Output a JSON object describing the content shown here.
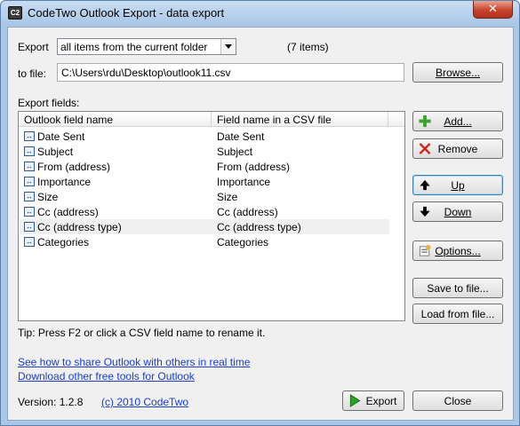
{
  "window": {
    "title": "CodeTwo Outlook Export - data export",
    "app_icon": "C2",
    "close_symbol": "✕"
  },
  "export": {
    "label": "Export",
    "selected_option": "all items from the current folder",
    "item_count": "(7 items)"
  },
  "to_file": {
    "label": "to file:",
    "value": "C:\\Users\\rdu\\Desktop\\outlook11.csv",
    "browse_label": "Browse..."
  },
  "fields": {
    "section_label": "Export fields:",
    "columns": [
      "Outlook field name",
      "Field name in a CSV file"
    ],
    "rows": [
      {
        "outlook": "Date Sent",
        "csv": "Date Sent"
      },
      {
        "outlook": "Subject",
        "csv": "Subject"
      },
      {
        "outlook": "From (address)",
        "csv": "From (address)"
      },
      {
        "outlook": "Importance",
        "csv": "Importance"
      },
      {
        "outlook": "Size",
        "csv": "Size"
      },
      {
        "outlook": "Cc (address)",
        "csv": "Cc (address)"
      },
      {
        "outlook": "Cc (address type)",
        "csv": "Cc (address type)"
      },
      {
        "outlook": "Categories",
        "csv": "Categories"
      }
    ],
    "selected_row": 6,
    "row_icon": "↔"
  },
  "side_buttons": {
    "add": "Add...",
    "remove": "Remove",
    "up": "Up",
    "down": "Down",
    "options": "Options...",
    "save_to_file": "Save to file...",
    "load_from_file": "Load from file..."
  },
  "tip": "Tip: Press F2 or click a CSV field name to rename it.",
  "links": {
    "share": "See how to share Outlook with others in real time",
    "download": "Download other free tools for Outlook",
    "copyright": "(c) 2010 CodeTwo"
  },
  "version": "Version: 1.2.8",
  "footer_buttons": {
    "export": "Export",
    "close": "Close"
  },
  "colors": {
    "link": "#1c3fc4",
    "add_icon": "#3aa12f",
    "remove_icon": "#d3261c",
    "export_icon": "#2f9e2a"
  }
}
